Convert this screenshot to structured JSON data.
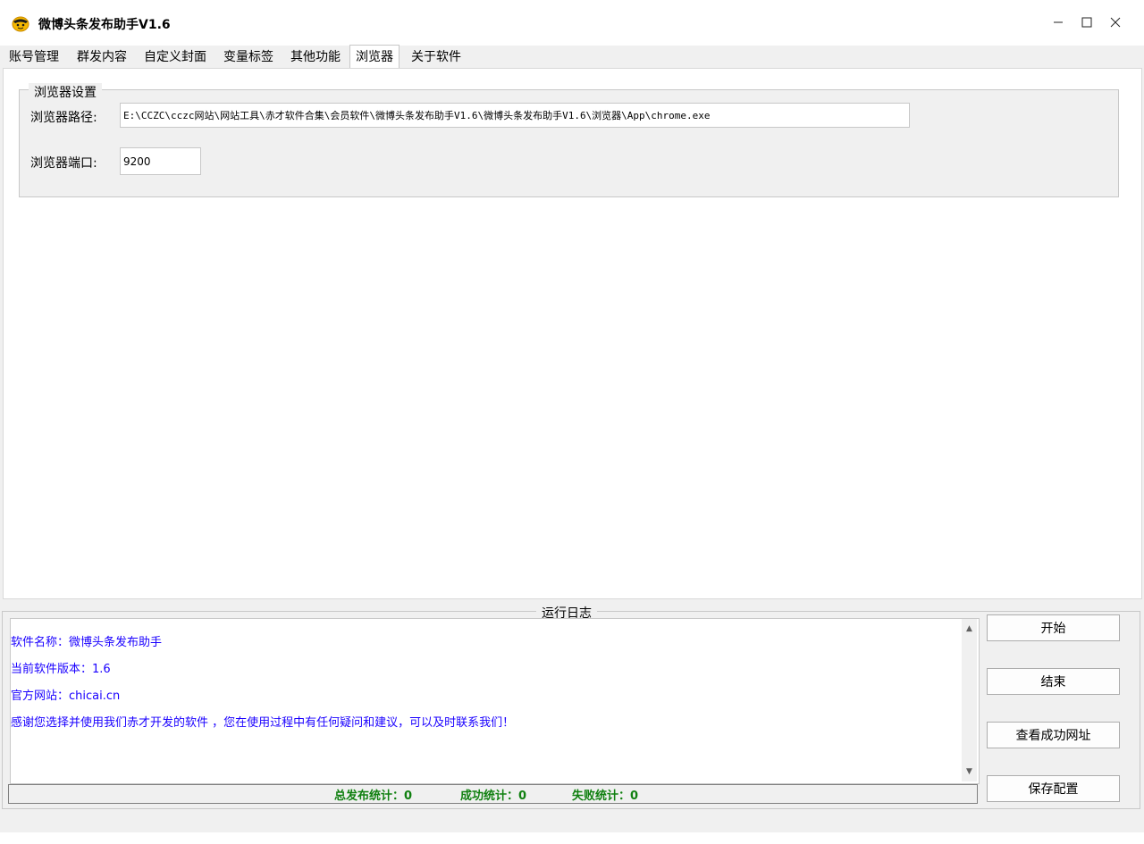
{
  "window": {
    "title": "微博头条发布助手V1.6",
    "controls": [
      "–",
      "☐",
      "✕"
    ]
  },
  "tabs": [
    {
      "label": "账号管理"
    },
    {
      "label": "群发内容"
    },
    {
      "label": "自定义封面"
    },
    {
      "label": "变量标签"
    },
    {
      "label": "其他功能"
    },
    {
      "label": "浏览器",
      "active": true
    },
    {
      "label": "关于软件"
    }
  ],
  "browser_settings": {
    "group_title": "浏览器设置",
    "path_label": "浏览器路径:",
    "path_value": "E:\\CCZC\\cczc网站\\网站工具\\赤才软件合集\\会员软件\\微博头条发布助手V1.6\\微博头条发布助手V1.6\\浏览器\\App\\chrome.exe",
    "port_label": "浏览器端口:",
    "port_value": "9200"
  },
  "log": {
    "title": "运行日志",
    "lines": [
      "软件名称：微博头条发布助手",
      "当前软件版本：1.6",
      "官方网站：chicai.cn",
      "感谢您选择并使用我们赤才开发的软件 ，您在使用过程中有任何疑问和建议，可以及时联系我们！"
    ]
  },
  "stats": {
    "total": "总发布统计：0",
    "success": "成功统计：0",
    "fail": "失败统计：0"
  },
  "buttons": {
    "start": "开始",
    "stop": "结束",
    "view_success": "查看成功网址",
    "save_config": "保存配置"
  },
  "colors": {
    "log_text": "#1a00ff",
    "stats_text": "#108010",
    "window_bg": "#f0f0f0"
  }
}
